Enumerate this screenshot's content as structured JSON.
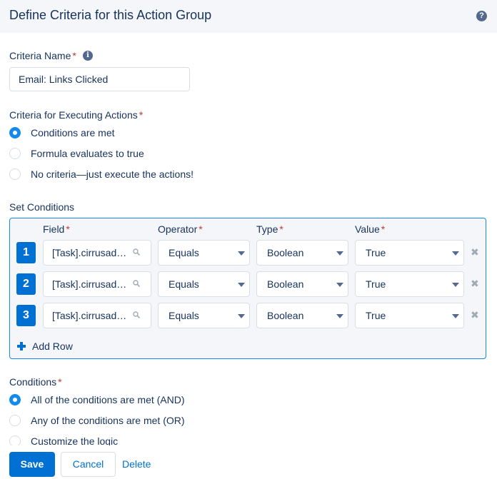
{
  "header": {
    "title": "Define Criteria for this Action Group",
    "help": "?"
  },
  "criteria_name": {
    "label": "Criteria Name",
    "required_mark": "*",
    "info": "i",
    "value": "Email: Links Clicked"
  },
  "executing": {
    "label": "Criteria for Executing Actions",
    "required_mark": "*",
    "options": [
      {
        "label": "Conditions are met",
        "checked": true
      },
      {
        "label": "Formula evaluates to true",
        "checked": false
      },
      {
        "label": "No criteria—just execute the actions!",
        "checked": false
      }
    ]
  },
  "set_conditions": {
    "label": "Set Conditions",
    "columns": {
      "field": "Field",
      "operator": "Operator",
      "type": "Type",
      "value": "Value",
      "required_mark": "*"
    },
    "rows": [
      {
        "num": "1",
        "field": "[Task].cirrusadv__Event_Type__c",
        "operator": "Equals",
        "type": "Boolean",
        "value": "True"
      },
      {
        "num": "2",
        "field": "[Task].cirrusadv__Event_Type__c",
        "operator": "Equals",
        "type": "Boolean",
        "value": "True"
      },
      {
        "num": "3",
        "field": "[Task].cirrusadv__Event_Type__c",
        "operator": "Equals",
        "type": "Boolean",
        "value": "True"
      }
    ],
    "remove_glyph": "✖",
    "add_row_label": "Add Row"
  },
  "conditions": {
    "label": "Conditions",
    "required_mark": "*",
    "options": [
      {
        "label": "All of the conditions are met (AND)",
        "checked": true
      },
      {
        "label": "Any of the conditions are met (OR)",
        "checked": false
      },
      {
        "label": "Customize the logic",
        "checked": false
      }
    ]
  },
  "footer": {
    "save": "Save",
    "cancel": "Cancel",
    "delete": "Delete"
  },
  "colors": {
    "brand": "#0070d2",
    "selected": "#1589ee",
    "text": "#16325c",
    "required": "#c23934"
  }
}
